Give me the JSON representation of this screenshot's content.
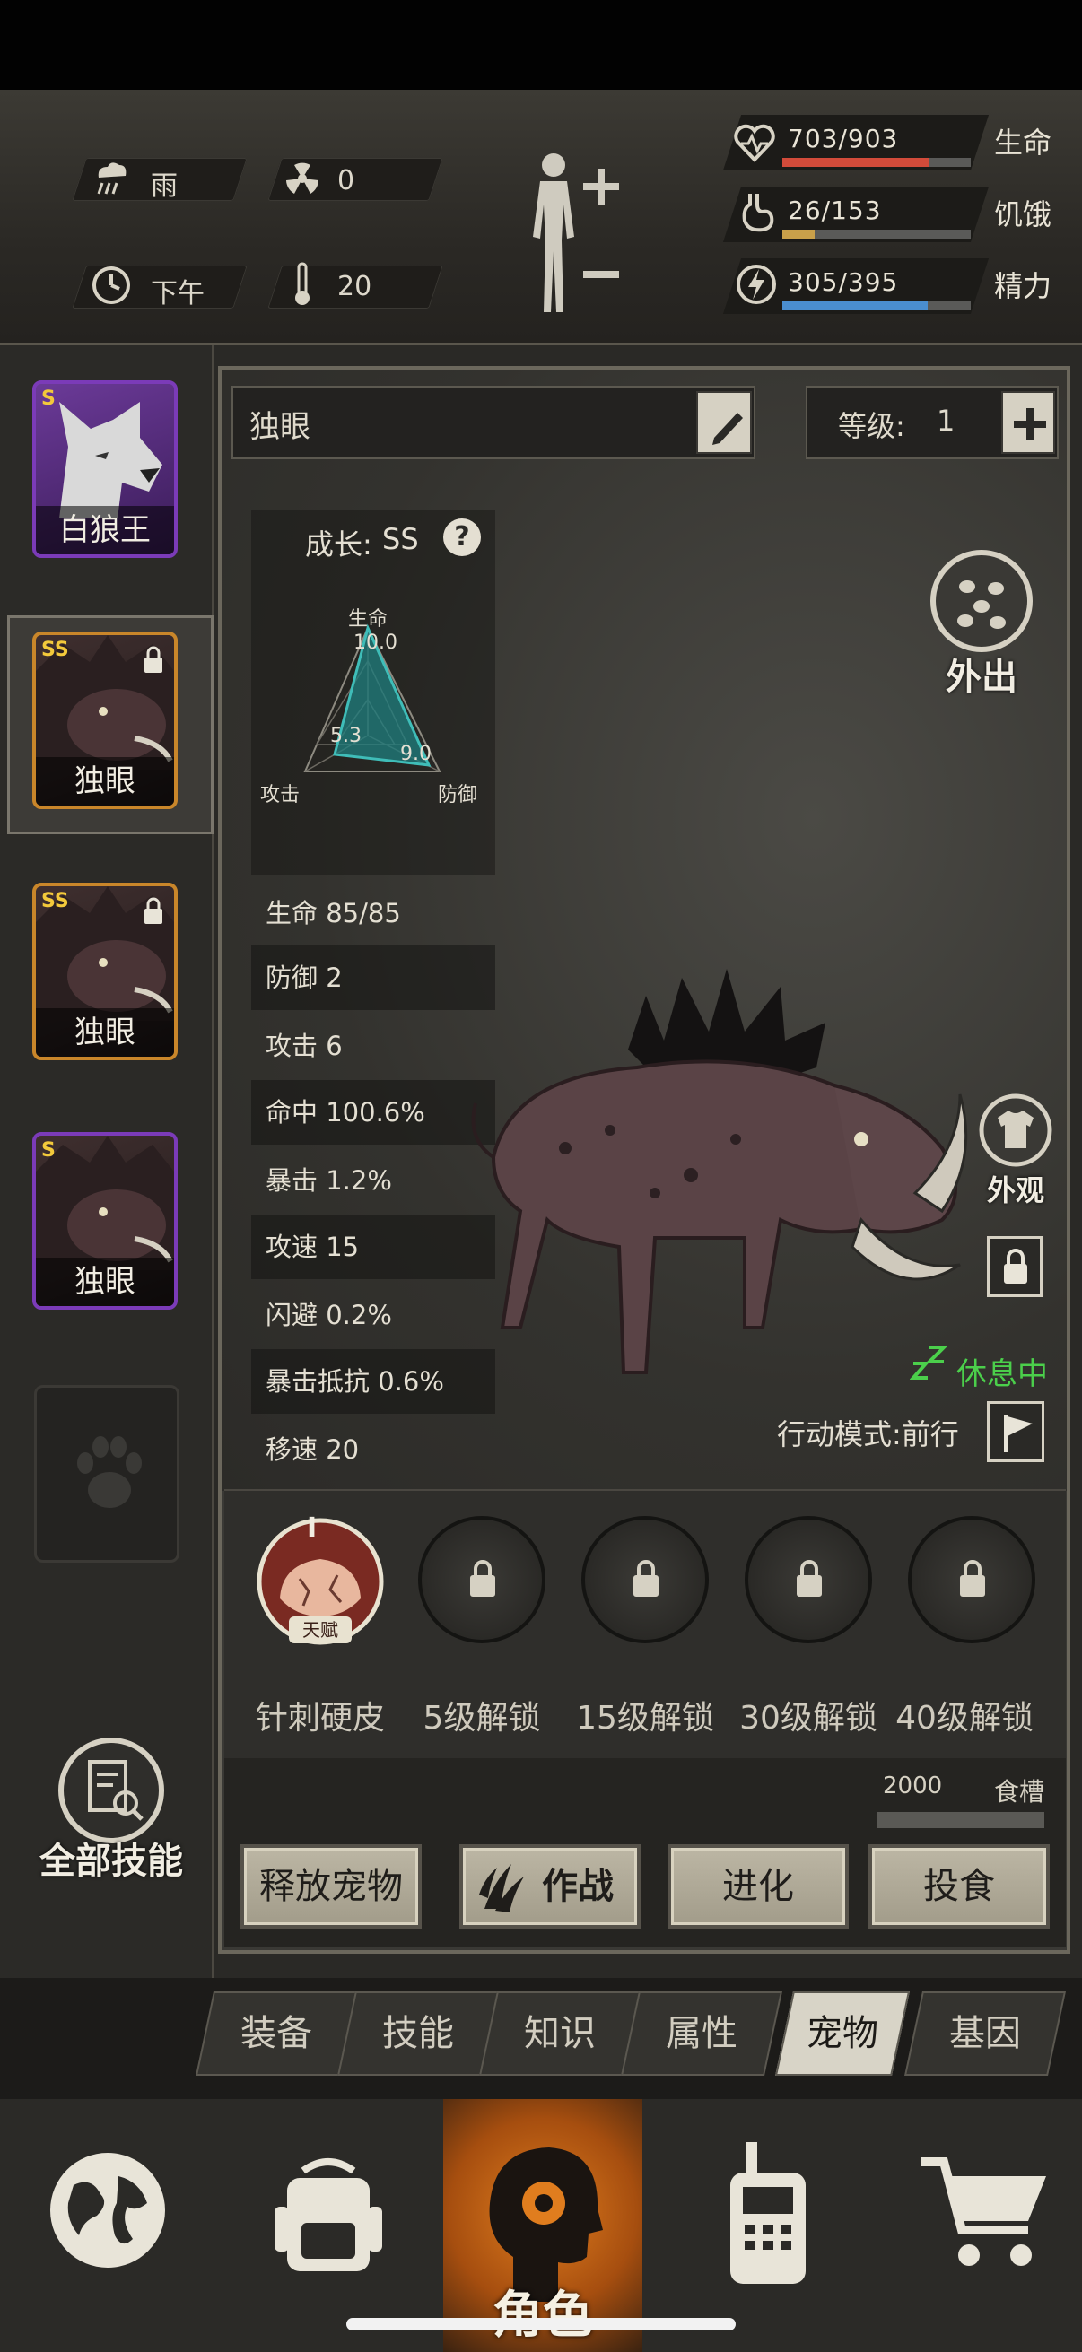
{
  "weather": {
    "condition": "雨",
    "radiation": "0",
    "time_of_day": "下午",
    "temperature": "20"
  },
  "vitals": [
    {
      "label": "生命",
      "value": "703/903",
      "fraction": 0.778,
      "color": "#d24b3a"
    },
    {
      "label": "饥饿",
      "value": "26/153",
      "fraction": 0.17,
      "color": "#c9a04a"
    },
    {
      "label": "精力",
      "value": "305/395",
      "fraction": 0.772,
      "color": "#4a8ed0"
    }
  ],
  "pets": [
    {
      "rank": "S",
      "name": "白狼王",
      "locked": false,
      "border": "#7b3bb8"
    },
    {
      "rank": "SS",
      "name": "独眼",
      "locked": true,
      "border": "#c9862a"
    },
    {
      "rank": "SS",
      "name": "独眼",
      "locked": true,
      "border": "#c9862a"
    },
    {
      "rank": "S",
      "name": "独眼",
      "locked": false,
      "border": "#7b3bb8"
    }
  ],
  "pet_detail": {
    "name": "独眼",
    "level_label": "等级:",
    "level": "1",
    "growth_label": "成长:",
    "growth": "SS",
    "radar": {
      "top_label": "生命",
      "left_label": "攻击",
      "right_label": "防御",
      "top_value": "10.0",
      "left_value": "5.3",
      "right_value": "9.0"
    },
    "stats": [
      "生命 85/85",
      "防御 2",
      "攻击 6",
      "命中 100.6%",
      "暴击 1.2%",
      "攻速 15",
      "闪避 0.2%",
      "暴击抵抗 0.6%",
      "移速 20"
    ],
    "go_out_label": "外出",
    "appearance_label": "外观",
    "status": "休息中",
    "action_mode": "行动模式:前行"
  },
  "skills": {
    "talent_badge": "天赋",
    "talent_roman": "I",
    "talent_name": "针刺硬皮",
    "slots": [
      "5级解锁",
      "15级解锁",
      "30级解锁",
      "40级解锁"
    ]
  },
  "trough": {
    "value": "2000",
    "label": "食槽"
  },
  "all_skills_label": "全部技能",
  "actions": [
    "释放宠物",
    "作战",
    "进化",
    "投食"
  ],
  "tabs": [
    {
      "label": "装备",
      "active": false
    },
    {
      "label": "技能",
      "active": false
    },
    {
      "label": "知识",
      "active": false
    },
    {
      "label": "属性",
      "active": false
    },
    {
      "label": "宠物",
      "active": true
    },
    {
      "label": "基因",
      "active": false
    }
  ],
  "nav": {
    "character_label": "角色"
  }
}
